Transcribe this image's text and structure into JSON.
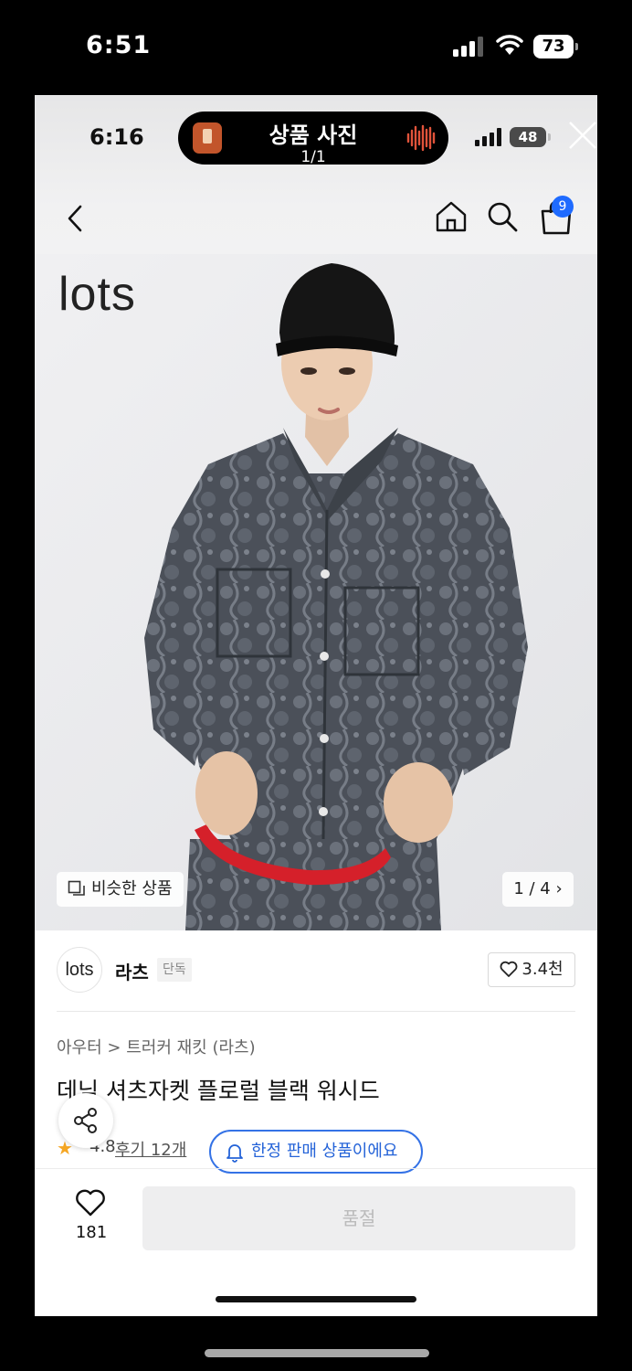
{
  "device_status": {
    "time": "6:51",
    "battery": "73"
  },
  "screenshot_status": {
    "time": "6:16",
    "battery": "48"
  },
  "dynamic_island": {
    "title": "상품 사진",
    "subtitle": "1/1"
  },
  "nav": {
    "cart_badge": "9"
  },
  "photo": {
    "brand_watermark": "lots",
    "similar_label": "비슷한 상품",
    "page_indicator": "1 / 4 ›"
  },
  "brand": {
    "logo_text": "lots",
    "name": "라츠",
    "tag": "단독",
    "likes": "3.4천"
  },
  "product": {
    "breadcrumb": "아우터 > 트러커 재킷 (라츠)",
    "title": "데님 셔츠자켓 플로럴 블랙 워시드",
    "rating": "4.8",
    "reviews": "후기 12개",
    "limited_label": "한정 판매 상품이에요"
  },
  "bottom_bar": {
    "wish_count": "181",
    "soldout_label": "품절"
  },
  "colors": {
    "accent_blue": "#2463d8",
    "badge_blue": "#1f6bff",
    "star": "#f5a623"
  }
}
